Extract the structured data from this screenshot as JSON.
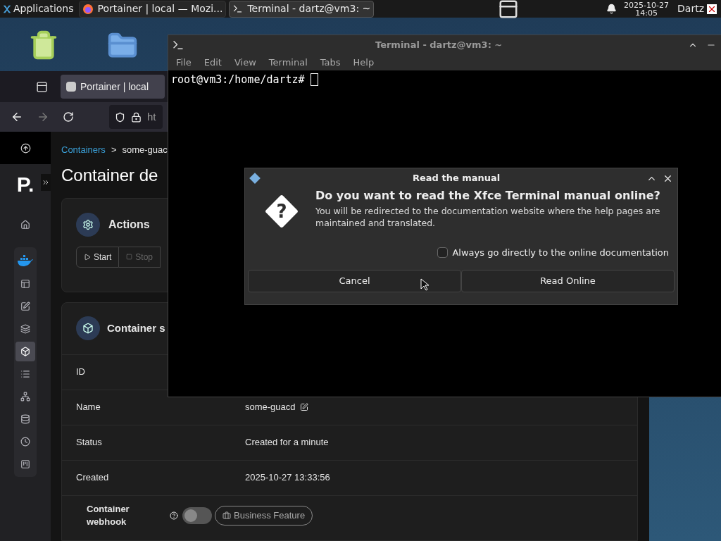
{
  "top_panel": {
    "menu": "Applications",
    "tasks": [
      {
        "label": "Portainer | local — Mozi...",
        "kind": "browser",
        "selected": false
      },
      {
        "label": "Terminal - dartz@vm3: ~",
        "kind": "terminal",
        "selected": true
      }
    ],
    "date": "2025-10-27",
    "time": "14:05",
    "user": "Dartz"
  },
  "browser": {
    "tab": "Portainer | local",
    "url": "ht"
  },
  "portainer": {
    "logo": "P.",
    "sidebar_items": [
      {
        "kind": "home",
        "selected": false
      },
      {
        "kind": "docker",
        "selected": false
      },
      {
        "kind": "dashboard",
        "selected": false
      },
      {
        "kind": "templates",
        "selected": false
      },
      {
        "kind": "stacks",
        "selected": false
      },
      {
        "kind": "containers",
        "selected": true
      },
      {
        "kind": "images",
        "selected": false
      },
      {
        "kind": "networks",
        "selected": false
      },
      {
        "kind": "volumes",
        "selected": false
      },
      {
        "kind": "events",
        "selected": false
      },
      {
        "kind": "host",
        "selected": false
      }
    ],
    "breadcrumb": {
      "link": "Containers",
      "separator": ">",
      "current": "some-guac"
    },
    "title": "Container de",
    "actions_card": {
      "title": "Actions",
      "buttons": [
        {
          "label": "Start",
          "kind": "start",
          "disabled": false
        },
        {
          "label": "Stop",
          "kind": "stop",
          "disabled": true
        }
      ]
    },
    "status_card": {
      "title": "Container s",
      "rows": [
        {
          "label": "ID"
        },
        {
          "label": "Name",
          "value": "some-guacd",
          "editable": true
        },
        {
          "label": "Status",
          "value": "Created for a minute",
          "editable": false
        },
        {
          "label": "Created",
          "value": "2025-10-27 13:33:56",
          "editable": false
        }
      ],
      "webhook": {
        "label": "Container webhook",
        "on": false,
        "badge": "Business Feature"
      }
    }
  },
  "terminal": {
    "title": "Terminal - dartz@vm3: ~",
    "menu": [
      "File",
      "Edit",
      "View",
      "Terminal",
      "Tabs",
      "Help"
    ],
    "prompt": "root@vm3:/home/dartz#"
  },
  "dialog": {
    "icon": "?",
    "title": "Read the manual",
    "heading": "Do you want to read the Xfce Terminal manual online?",
    "body": "You will be redirected to the documentation website where the help pages are maintained and translated.",
    "checkbox": {
      "label": "Always go directly to the online documentation",
      "checked": false
    },
    "buttons": [
      "Cancel",
      "Read Online"
    ]
  }
}
